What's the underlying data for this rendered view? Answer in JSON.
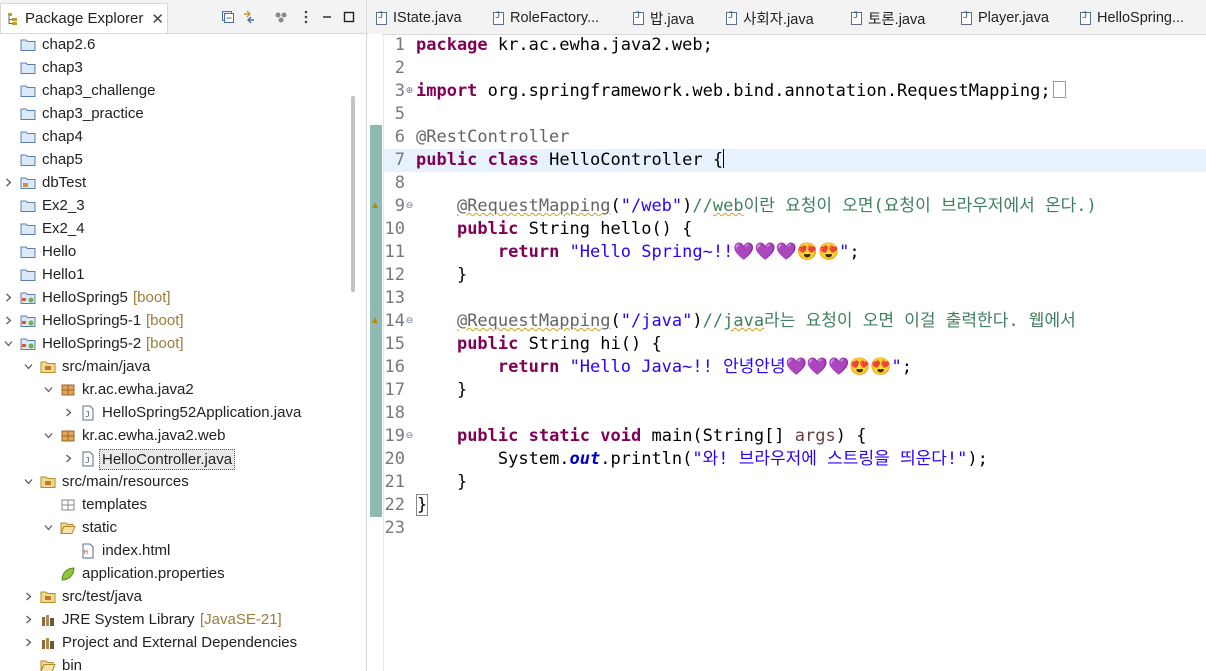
{
  "explorer": {
    "tab_label": "Package Explorer",
    "tab_close": "✕",
    "tree": [
      {
        "label": "chap2.6",
        "depth": 0,
        "chevron": "",
        "icon": "folder-icon",
        "suffix": ""
      },
      {
        "label": "chap3",
        "depth": 0,
        "chevron": "",
        "icon": "folder-icon",
        "suffix": ""
      },
      {
        "label": "chap3_challenge",
        "depth": 0,
        "chevron": "",
        "icon": "folder-icon",
        "suffix": ""
      },
      {
        "label": "chap3_practice",
        "depth": 0,
        "chevron": "",
        "icon": "folder-icon",
        "suffix": ""
      },
      {
        "label": "chap4",
        "depth": 0,
        "chevron": "",
        "icon": "folder-icon",
        "suffix": ""
      },
      {
        "label": "chap5",
        "depth": 0,
        "chevron": "",
        "icon": "folder-icon",
        "suffix": ""
      },
      {
        "label": "dbTest",
        "depth": 0,
        "chevron": ">",
        "icon": "project-icon",
        "suffix": ""
      },
      {
        "label": "Ex2_3",
        "depth": 0,
        "chevron": "",
        "icon": "folder-icon",
        "suffix": ""
      },
      {
        "label": "Ex2_4",
        "depth": 0,
        "chevron": "",
        "icon": "folder-icon",
        "suffix": ""
      },
      {
        "label": "Hello",
        "depth": 0,
        "chevron": "",
        "icon": "folder-icon",
        "suffix": ""
      },
      {
        "label": "Hello1",
        "depth": 0,
        "chevron": "",
        "icon": "folder-icon",
        "suffix": ""
      },
      {
        "label": "HelloSpring5",
        "depth": 0,
        "chevron": ">",
        "icon": "spring-project-icon",
        "suffix": "[boot]"
      },
      {
        "label": "HelloSpring5-1",
        "depth": 0,
        "chevron": ">",
        "icon": "spring-project-icon",
        "suffix": "[boot]"
      },
      {
        "label": "HelloSpring5-2",
        "depth": 0,
        "chevron": "v",
        "icon": "spring-project-icon",
        "suffix": "[boot]"
      },
      {
        "label": "src/main/java",
        "depth": 1,
        "chevron": "v",
        "icon": "source-folder-icon",
        "suffix": ""
      },
      {
        "label": "kr.ac.ewha.java2",
        "depth": 2,
        "chevron": "v",
        "icon": "package-icon",
        "suffix": ""
      },
      {
        "label": "HelloSpring52Application.java",
        "depth": 3,
        "chevron": ">",
        "icon": "java-file-icon",
        "suffix": ""
      },
      {
        "label": "kr.ac.ewha.java2.web",
        "depth": 2,
        "chevron": "v",
        "icon": "package-icon",
        "suffix": ""
      },
      {
        "label": "HelloController.java",
        "depth": 3,
        "chevron": ">",
        "icon": "java-file-icon",
        "suffix": "",
        "selected": true
      },
      {
        "label": "src/main/resources",
        "depth": 1,
        "chevron": "v",
        "icon": "source-folder-icon",
        "suffix": ""
      },
      {
        "label": "templates",
        "depth": 2,
        "chevron": "",
        "icon": "empty-package-icon",
        "suffix": ""
      },
      {
        "label": "static",
        "depth": 2,
        "chevron": "v",
        "icon": "open-folder-icon",
        "suffix": ""
      },
      {
        "label": "index.html",
        "depth": 3,
        "chevron": "",
        "icon": "html-file-icon",
        "suffix": ""
      },
      {
        "label": "application.properties",
        "depth": 2,
        "chevron": "",
        "icon": "properties-leaf-icon",
        "suffix": ""
      },
      {
        "label": "src/test/java",
        "depth": 1,
        "chevron": ">",
        "icon": "source-folder-icon",
        "suffix": ""
      },
      {
        "label": "JRE System Library",
        "depth": 1,
        "chevron": ">",
        "icon": "library-icon",
        "suffix": "[JavaSE-21]"
      },
      {
        "label": "Project and External Dependencies",
        "depth": 1,
        "chevron": ">",
        "icon": "library-icon",
        "suffix": ""
      },
      {
        "label": "bin",
        "depth": 1,
        "chevron": "",
        "icon": "open-folder-icon",
        "suffix": ""
      }
    ]
  },
  "editor_tabs": [
    {
      "label": "IState.java"
    },
    {
      "label": "RoleFactory..."
    },
    {
      "label": "밥.java"
    },
    {
      "label": "사회자.java"
    },
    {
      "label": "토론.java"
    },
    {
      "label": "Player.java"
    },
    {
      "label": "HelloSpring..."
    }
  ],
  "code": {
    "lines": [
      {
        "n": "1"
      },
      {
        "n": "2"
      },
      {
        "n": "3"
      },
      {
        "n": "5"
      },
      {
        "n": "6"
      },
      {
        "n": "7"
      },
      {
        "n": "8"
      },
      {
        "n": "9"
      },
      {
        "n": "10"
      },
      {
        "n": "11"
      },
      {
        "n": "12"
      },
      {
        "n": "13"
      },
      {
        "n": "14"
      },
      {
        "n": "15"
      },
      {
        "n": "16"
      },
      {
        "n": "17"
      },
      {
        "n": "18"
      },
      {
        "n": "19"
      },
      {
        "n": "20"
      },
      {
        "n": "21"
      },
      {
        "n": "22"
      },
      {
        "n": "23"
      }
    ],
    "t": {
      "package_kw": "package",
      "package_name": " kr.ac.ewha.java2.web;",
      "import_kw": "import",
      "import_name": " org.springframework.web.bind.annotation.RequestMapping;",
      "rest_annotation": "@RestController",
      "public_kw": "public",
      "class_kw": "class",
      "class_name": " HelloController {",
      "indent1": "    ",
      "indent2": "        ",
      "request_mapping": "@RequestMapping",
      "open_paren": "(",
      "web_path": "\"/web\"",
      "close_paren": ")",
      "comment1_a": "//",
      "comment1_b": "web",
      "comment1_c": "이란 요청이 오면(요청이 브라우저에서 온다.)",
      "string_type": " String",
      "hello_sig": " hello() {",
      "return_kw": "return",
      "hello_str": "\"Hello Spring~!!",
      "hello_emoji": "💜💜💜😍😍",
      "str_end": "\"",
      "semi": ";",
      "close_brace": "}",
      "java_path": "\"/java\"",
      "comment2_a": "//",
      "comment2_b": "java",
      "comment2_c": "라는 요청이 오면 이걸 출력한다. 웹에서",
      "hi_sig": " hi() {",
      "hi_str": "\"Hello Java~!! 안녕안녕",
      "hi_emoji": "💜💜💜😍😍",
      "static_kw": "static",
      "void_kw": "void",
      "main_sig_a": " main(String[] ",
      "main_args": "args",
      "main_sig_b": ") {",
      "system": "System.",
      "out": "out",
      "println_a": ".println(",
      "println_str": "\"와! 브라우저에 스트링을 띄운다!\"",
      "println_b": ");",
      "final_brace": "}"
    }
  }
}
